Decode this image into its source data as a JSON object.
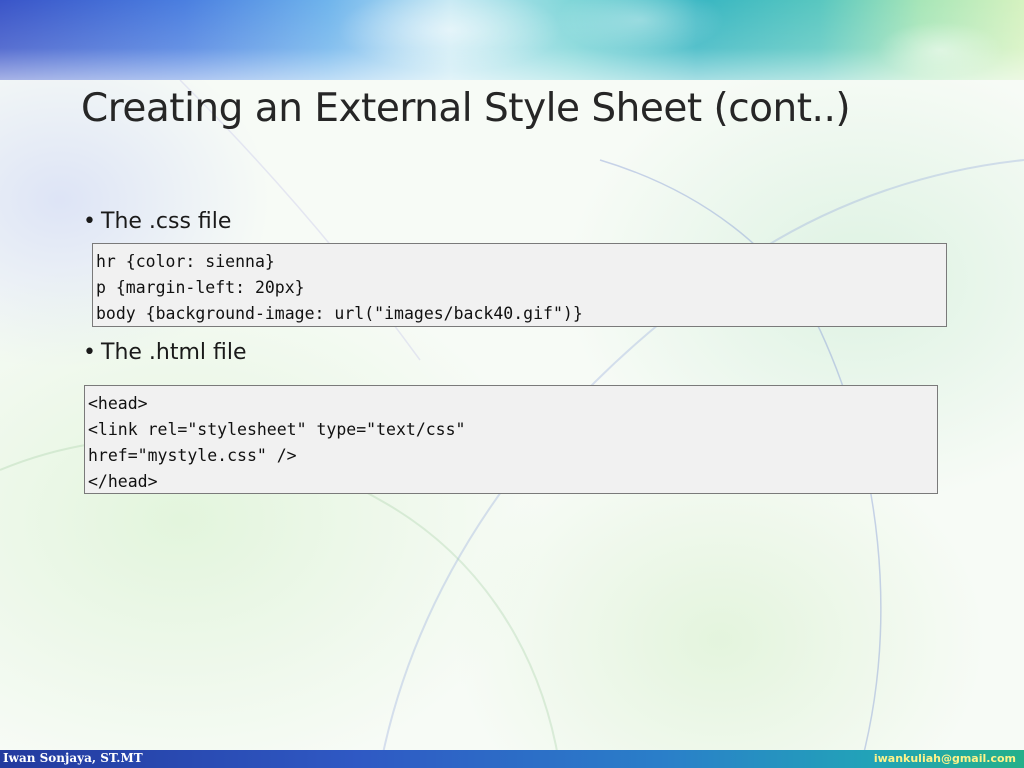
{
  "slide": {
    "title": "Creating an External Style Sheet (cont..)",
    "bullets": [
      {
        "label": "The .css file",
        "code": [
          "hr {color: sienna}",
          "p {margin-left: 20px}",
          "body {background-image: url(\"images/back40.gif\")}"
        ]
      },
      {
        "label": "The .html file",
        "code": [
          "<head>",
          "<link rel=\"stylesheet\" type=\"text/css\"",
          "href=\"mystyle.css\" />",
          "</head>"
        ]
      }
    ],
    "bullet_glyph": "•"
  },
  "footer": {
    "author": "Iwan Sonjaya, ST.MT",
    "email": "iwankuliah@gmail.com"
  },
  "colors": {
    "footer_bar": "#2f59c4",
    "email_text": "#fff38a",
    "code_background": "#f1f1f1"
  }
}
